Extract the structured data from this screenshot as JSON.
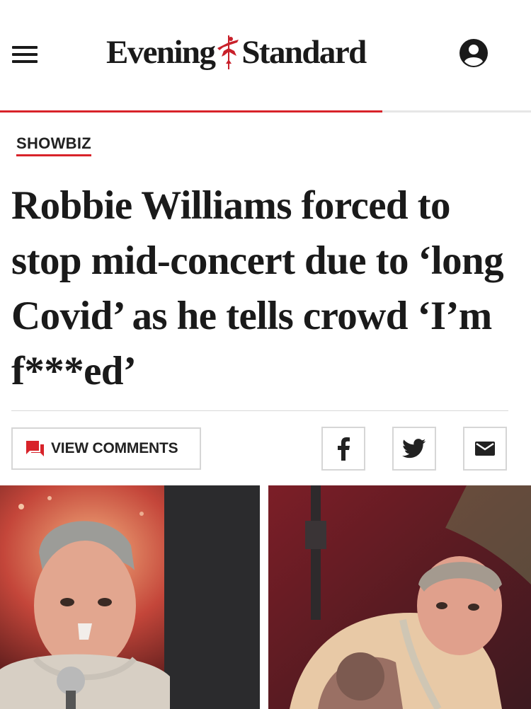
{
  "header": {
    "menu_icon": "hamburger-menu-icon",
    "logo": {
      "word_left": "Evening",
      "word_right": "Standard",
      "emblem": "winged-figure-emblem"
    },
    "account_icon": "account-circle-icon"
  },
  "reading_progress": 0.72,
  "article": {
    "section": "SHOWBIZ",
    "headline": "Robbie Williams forced to stop mid-concert due to ‘long Covid’ as he tells crowd ‘I’m f***ed’"
  },
  "actions": {
    "comments_label": "VIEW COMMENTS",
    "comments_icon": "comment-bubble-icon",
    "share": [
      {
        "network": "facebook",
        "icon": "facebook-icon"
      },
      {
        "network": "twitter",
        "icon": "twitter-bird-icon"
      },
      {
        "network": "email",
        "icon": "envelope-icon"
      }
    ]
  },
  "colors": {
    "accent": "#d8232a",
    "text": "#1a1a1a",
    "border": "#d6d6d6"
  }
}
